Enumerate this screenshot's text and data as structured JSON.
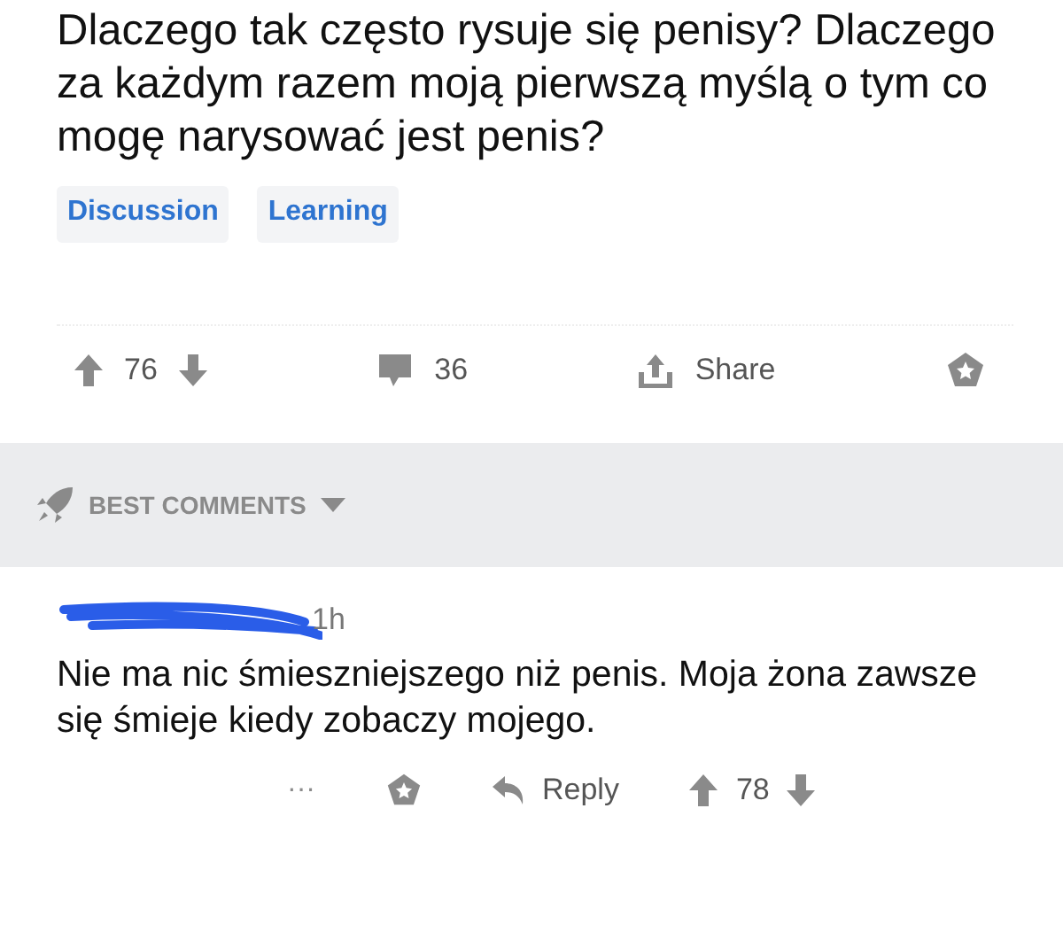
{
  "post": {
    "title": "Dlaczego tak często rysuje się penisy? Dlaczego za każdym razem moją pierwszą myślą o tym co mogę narysować jest penis?",
    "tags": [
      "Discussion",
      "Learning"
    ],
    "votes": "76",
    "comments": "36",
    "share": "Share"
  },
  "comments_header": {
    "label": "BEST COMMENTS"
  },
  "comment": {
    "time": "1h",
    "text": "Nie ma nic śmieszniejszego niż penis. Moja żona zawsze się śmieje kiedy zobaczy mojego.",
    "more": "···",
    "reply": "Reply",
    "votes": "78"
  }
}
